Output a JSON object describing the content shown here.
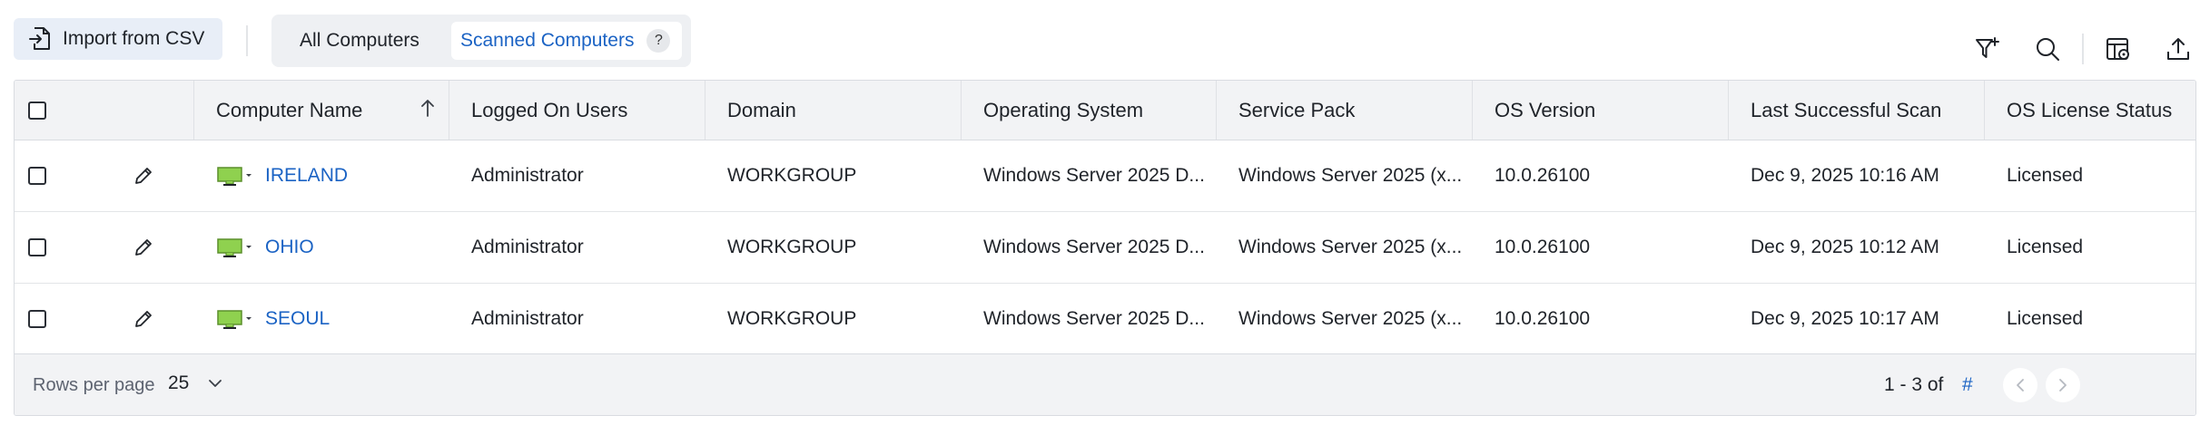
{
  "toolbar": {
    "import_label": "Import from CSV",
    "tabs": [
      {
        "label": "All Computers",
        "selected": false
      },
      {
        "label": "Scanned Computers",
        "selected": true
      }
    ],
    "help_glyph": "?",
    "icons": [
      "add-filter-icon",
      "search-icon",
      "column-settings-icon",
      "export-icon"
    ]
  },
  "table": {
    "columns": [
      "Computer Name",
      "Logged On Users",
      "Domain",
      "Operating System",
      "Service Pack",
      "OS Version",
      "Last Successful Scan",
      "OS License Status"
    ],
    "sorted_column": "Computer Name",
    "sort_direction": "ascending",
    "rows": [
      {
        "name": "IRELAND",
        "users": "Administrator",
        "domain": "WORKGROUP",
        "os": "Windows Server 2025 D...",
        "sp": "Windows Server 2025 (x...",
        "version": "10.0.26100",
        "scan": "Dec 9, 2025 10:16 AM",
        "license": "Licensed"
      },
      {
        "name": "OHIO",
        "users": "Administrator",
        "domain": "WORKGROUP",
        "os": "Windows Server 2025 D...",
        "sp": "Windows Server 2025 (x...",
        "version": "10.0.26100",
        "scan": "Dec 9, 2025 10:12 AM",
        "license": "Licensed"
      },
      {
        "name": "SEOUL",
        "users": "Administrator",
        "domain": "WORKGROUP",
        "os": "Windows Server 2025 D...",
        "sp": "Windows Server 2025 (x...",
        "version": "10.0.26100",
        "scan": "Dec 9, 2025 10:17 AM",
        "license": "Licensed"
      }
    ]
  },
  "footer": {
    "rows_per_page_label": "Rows per page",
    "rows_per_page_value": "25",
    "range_text": "1 - 3 of",
    "range_total": "#"
  },
  "colors": {
    "accent": "#1b63c4",
    "computer_icon": "#8fd14f",
    "header_bg": "#f2f3f5"
  }
}
